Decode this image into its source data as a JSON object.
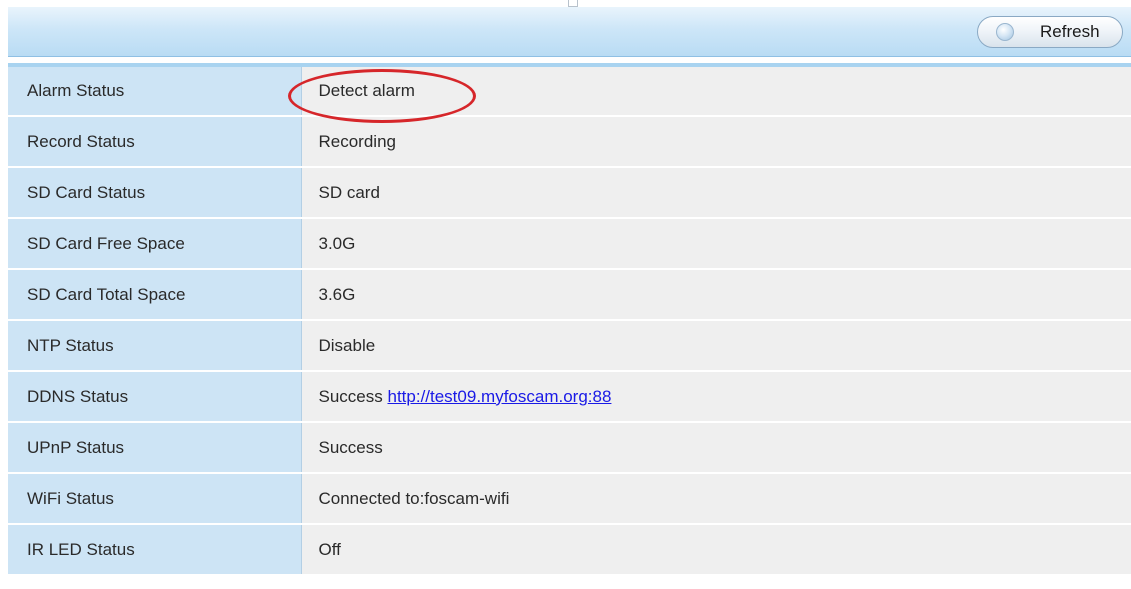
{
  "toolbar": {
    "refresh_label": "Refresh"
  },
  "status": {
    "rows": [
      {
        "label": "Alarm Status",
        "value": "Detect alarm"
      },
      {
        "label": "Record Status",
        "value": "Recording"
      },
      {
        "label": "SD Card Status",
        "value": "SD card"
      },
      {
        "label": "SD Card Free Space",
        "value": "3.0G"
      },
      {
        "label": "SD Card Total Space",
        "value": "3.6G"
      },
      {
        "label": "NTP Status",
        "value": "Disable"
      },
      {
        "label": "DDNS Status",
        "value": "Success",
        "link": "http://test09.myfoscam.org:88"
      },
      {
        "label": "UPnP Status",
        "value": "Success"
      },
      {
        "label": "WiFi Status",
        "value": "Connected to:foscam-wifi"
      },
      {
        "label": "IR LED Status",
        "value": "Off"
      }
    ]
  },
  "colors": {
    "label_cell_bg": "#cde4f5",
    "value_cell_bg": "#efefef",
    "highlight_ellipse": "#d6262a",
    "link": "#1a1ae6"
  },
  "icons": {
    "refresh": "refresh-icon"
  }
}
